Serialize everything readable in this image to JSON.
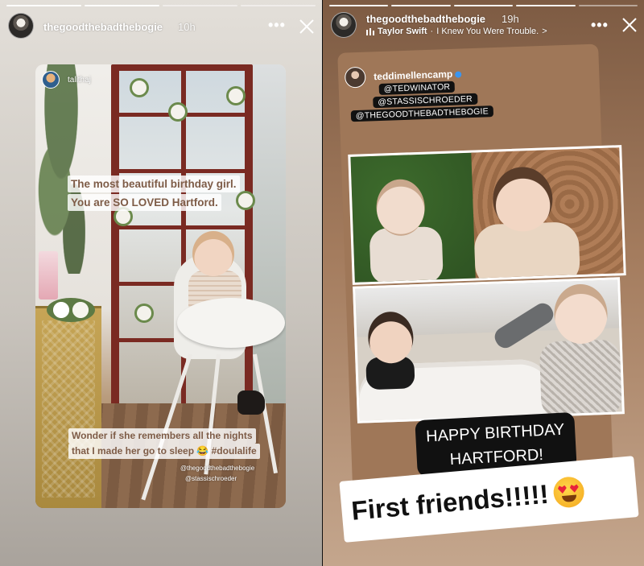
{
  "left_story": {
    "username": "thegoodthebadthebogie",
    "time": "10h",
    "card": {
      "username": "talithaj",
      "caption_lines": [
        "The most beautiful birthday girl.",
        "You are SO LOVED Hartford."
      ],
      "bottom_caption_lines": [
        "Wonder if she remembers all the nights",
        "that I made her go to sleep 😂 #doulalife"
      ],
      "tags": [
        "@thegoodthebadthebogie",
        "@stassischroeder"
      ]
    },
    "more_label": "•••",
    "close_icon": "close-icon"
  },
  "right_story": {
    "username": "thegoodthebadthebogie",
    "time": "19h",
    "music": {
      "artist": "Taylor Swift",
      "separator": "·",
      "song": "I Knew You Were Trouble.",
      "chevron": ">"
    },
    "card": {
      "username": "teddimellencamp",
      "mentions": [
        "@TEDWINATOR",
        "@STASSISCHROEDER",
        "@THEGOODTHEBADTHEBOGIE"
      ]
    },
    "birthday_lines": [
      "HAPPY BIRTHDAY",
      "HARTFORD!"
    ],
    "friends_text": "First friends!!!!!",
    "more_label": "•••",
    "close_icon": "close-icon"
  },
  "colors": {
    "caption_text": "#7e5c47",
    "right_bg": "#a47c5e",
    "verified": "#3a95f0"
  }
}
